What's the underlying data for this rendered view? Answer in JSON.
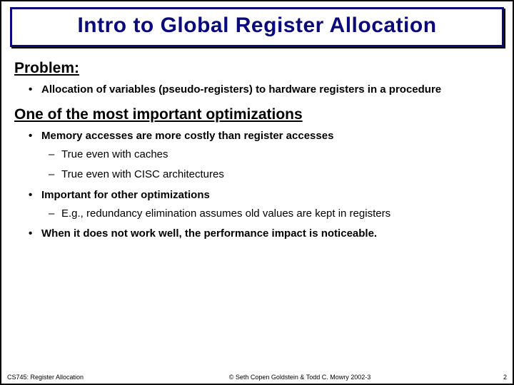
{
  "title": "Intro to Global Register Allocation",
  "sections": [
    {
      "heading": "Problem:",
      "bullets": [
        {
          "text": "Allocation of variables (pseudo-registers) to hardware registers in a procedure"
        }
      ]
    },
    {
      "heading": "One of the most important optimizations",
      "bullets": [
        {
          "text": "Memory accesses are more costly than register accesses",
          "sub": [
            "True even with caches",
            "True even with CISC architectures"
          ]
        },
        {
          "text": "Important for other optimizations",
          "sub": [
            "E.g., redundancy elimination assumes old values are kept in registers"
          ]
        },
        {
          "text": "When it does not work well, the performance impact is noticeable."
        }
      ]
    }
  ],
  "footer": {
    "left": "CS745: Register Allocation",
    "center": "© Seth Copen Goldstein & Todd C. Mowry 2002-3",
    "right": "2"
  }
}
